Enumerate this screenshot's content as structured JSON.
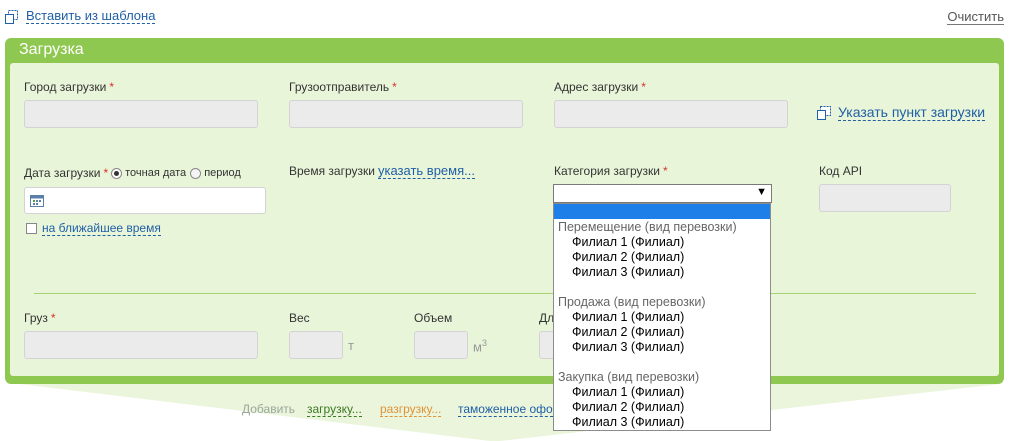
{
  "top": {
    "template_link": "Вставить из шаблона",
    "template_icon": "paste-template-icon",
    "clear_link": "Очистить"
  },
  "panel": {
    "title": "Загрузка",
    "fields": {
      "city_label": "Город загрузки",
      "shipper_label": "Грузоотправитель",
      "address_label": "Адрес загрузки",
      "point_link": "Указать пункт загрузки",
      "point_icon": "map-point-icon",
      "date_label": "Дата загрузки",
      "date_exact": "точная дата",
      "date_period": "период",
      "date_icon": "calendar-icon",
      "nearest_time": "на ближайшее время",
      "time_label": "Время загрузки",
      "time_link": "указать время...",
      "category_label": "Категория загрузки",
      "api_label": "Код API",
      "cargo_label": "Груз",
      "weight_label": "Вес",
      "weight_unit": "т",
      "volume_label": "Объем",
      "volume_unit": "м",
      "volume_unit_sup": "3",
      "length_label_partial": "Дл"
    },
    "required_mark": "*"
  },
  "dropdown": {
    "selected": "",
    "groups": [
      {
        "label": "Перемещение (вид перевозки)",
        "options": [
          "Филиал 1 (Филиал)",
          "Филиал 2 (Филиал)",
          "Филиал 3 (Филиал)"
        ]
      },
      {
        "label": "Продажа (вид перевозки)",
        "options": [
          "Филиал 1 (Филиал)",
          "Филиал 2 (Филиал)",
          "Филиал 3 (Филиал)"
        ]
      },
      {
        "label": "Закупка (вид перевозки)",
        "options": [
          "Филиал 1 (Филиал)",
          "Филиал 2 (Филиал)",
          "Филиал 3 (Филиал)"
        ]
      }
    ]
  },
  "bottom": {
    "add_label": "Добавить",
    "loading_link": "загрузку...",
    "unloading_link": "разгрузку...",
    "customs_link": "таможенное офо"
  },
  "colors": {
    "panel_green": "#8fc850",
    "panel_inner": "#e9f5d9",
    "link_blue": "#1f5fa6",
    "required_red": "#d9312b",
    "select_highlight": "#1e7fe8"
  }
}
